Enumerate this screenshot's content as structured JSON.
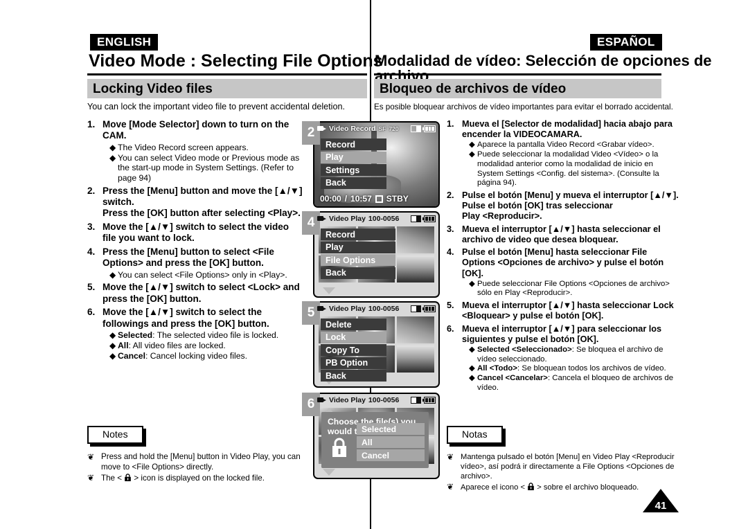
{
  "header": {
    "english_tag": "ENGLISH",
    "spanish_tag": "ESPAÑOL",
    "chapter_en": "Video Mode : Selecting File Options",
    "chapter_es": "Modalidad de vídeo: Selección de opciones de archivo",
    "section_en": "Locking Video files",
    "section_es": "Bloqueo de archivos de vídeo",
    "intro_en": "You can lock the important video file to prevent accidental deletion.",
    "intro_es": "Es posible bloquear archivos de vídeo importantes para evitar el borrado accidental."
  },
  "steps_en": [
    {
      "num": "1.",
      "title": "Move [Mode Selector] down to turn on the CAM.",
      "bullets": [
        {
          "lead": "",
          "text": "The Video Record screen appears."
        },
        {
          "lead": "",
          "text": "You can select Video mode or Previous mode as the start-up mode in System Settings. (Refer to page 94)"
        }
      ]
    },
    {
      "num": "2.",
      "title": "Press the [Menu] button and move the [▲/▼] switch.\nPress the [OK] button after selecting <Play>.",
      "bullets": []
    },
    {
      "num": "3.",
      "title": "Move the [▲/▼] switch to select the video file you want to lock.",
      "bullets": []
    },
    {
      "num": "4.",
      "title": "Press the [Menu] button to select <File Options> and press the [OK] button.",
      "bullets": [
        {
          "lead": "",
          "text": "You can select <File Options> only in <Play>."
        }
      ]
    },
    {
      "num": "5.",
      "title": "Move the [▲/▼] switch to select <Lock> and press the [OK] button.",
      "bullets": []
    },
    {
      "num": "6.",
      "title": "Move the [▲/▼] switch to select the followings and press the [OK] button.",
      "bullets": [
        {
          "lead": "Selected",
          "text": ": The selected video file is locked."
        },
        {
          "lead": "All",
          "text": ": All video files are locked."
        },
        {
          "lead": "Cancel",
          "text": ": Cancel locking video files."
        }
      ]
    }
  ],
  "steps_es": [
    {
      "num": "1.",
      "title": "Mueva el [Selector de modalidad] hacia abajo para encender la VIDEOCAMARA.",
      "bullets": [
        {
          "lead": "",
          "text": "Aparece la pantalla Video Record <Grabar vídeo>."
        },
        {
          "lead": "",
          "text": "Puede seleccionar la modalidad Video <Vídeo> o la modalidad anterior como la modalidad de inicio en System Settings <Config. del sistema>. (Consulte la página 94)."
        }
      ]
    },
    {
      "num": "2.",
      "title": "Pulse el botón [Menu] y mueva el interruptor [▲/▼]. Pulse el botón [OK] tras seleccionar\nPlay <Reproducir>.",
      "bullets": []
    },
    {
      "num": "3.",
      "title": "Mueva el interruptor [▲/▼] hasta seleccionar el archivo de video que desea bloquear.",
      "bullets": []
    },
    {
      "num": "4.",
      "title": "Pulse el botón [Menu] hasta seleccionar File Options <Opciones de archivo> y pulse el botón [OK].",
      "bullets": [
        {
          "lead": "",
          "text": "Puede seleccionar File Options <Opciones de archivo> sólo en Play <Reproducir>."
        }
      ]
    },
    {
      "num": "5.",
      "title": "Mueva el interruptor [▲/▼] hasta seleccionar Lock <Bloquear> y pulse el botón [OK].",
      "bullets": []
    },
    {
      "num": "6.",
      "title": "Mueva el interruptor [▲/▼] para seleccionar los siguientes y pulse el botón [OK].",
      "bullets": [
        {
          "lead": "Selected <Seleccionado>",
          "text": ": Se bloquea el archivo de vídeo seleccionado."
        },
        {
          "lead": "All <Todo>",
          "text": ": Se bloquean todos los archivos de vídeo."
        },
        {
          "lead": "Cancel <Cancelar>",
          "text": ": Cancela el bloqueo de archivos de vídeo."
        }
      ]
    }
  ],
  "notes_en": {
    "title": "Notes",
    "items": [
      "Press and hold the [Menu] button in Video Play, you can move to <File Options> directly.",
      "The <  > icon is displayed on the locked file."
    ],
    "item2_pre": "The < ",
    "item2_post": " > icon is displayed on the locked file."
  },
  "notes_es": {
    "title": "Notas",
    "items": [
      "Mantenga pulsado el botón [Menu] en Video Play <Reproducir vídeo>, así podrá ir directamente a File Options <Opciones de archivo>.",
      "Aparece el icono <  > sobre el archivo bloqueado."
    ],
    "item2_pre": "Aparece el icono < ",
    "item2_post": " > sobre el archivo bloqueado."
  },
  "lcd_screens": [
    {
      "step_label": "2",
      "title": "Video Record",
      "quality": "SF",
      "resolution": "720",
      "menu": [
        {
          "label": "Record",
          "state": "highlight"
        },
        {
          "label": "Play",
          "state": "normal"
        },
        {
          "label": "Settings",
          "state": "highlight"
        },
        {
          "label": "Back",
          "state": "highlight"
        }
      ],
      "time_elapsed": "00:00",
      "time_total": "10:57",
      "mode_status": "STBY"
    },
    {
      "step_label": "4",
      "title": "Video Play",
      "file_number": "100-0056",
      "menu": [
        {
          "label": "Record",
          "state": "highlight"
        },
        {
          "label": "Play",
          "state": "highlight"
        },
        {
          "label": "File Options",
          "state": "normal"
        },
        {
          "label": "Back",
          "state": "highlight"
        }
      ]
    },
    {
      "step_label": "5",
      "title": "Video Play",
      "file_number": "100-0056",
      "menu": [
        {
          "label": "Delete",
          "state": "highlight"
        },
        {
          "label": "Lock",
          "state": "normal"
        },
        {
          "label": "Copy To",
          "state": "highlight"
        },
        {
          "label": "PB Option",
          "state": "highlight"
        },
        {
          "label": "Back",
          "state": "highlight"
        }
      ]
    },
    {
      "step_label": "6",
      "title": "Video Play",
      "file_number": "100-0056",
      "dialog_text": "Choose the file(s) you would to lock.",
      "dialog_options": [
        "Selected",
        "All",
        "Cancel"
      ]
    }
  ],
  "page_number": "41",
  "colors": {
    "section_bar": "#c6c6c6",
    "step_box": "#9e9e9e",
    "menu_highlight": "#3b3b3b",
    "menu_normal": "#a6a6a6",
    "dialog_bg": "#808080"
  }
}
